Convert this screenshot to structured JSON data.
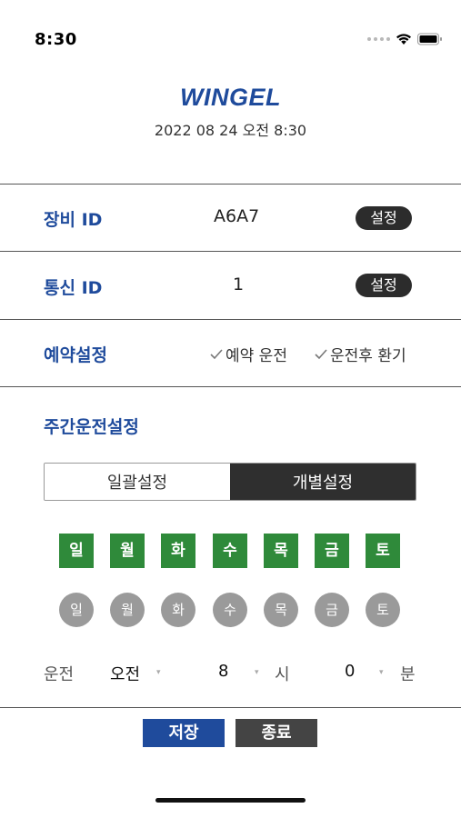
{
  "status": {
    "time": "8:30"
  },
  "header": {
    "logo": "WINGEL",
    "datetime": "2022 08 24 오전 8:30"
  },
  "device_id": {
    "label": "장비 ID",
    "value": "A6A7",
    "button": "설정"
  },
  "comm_id": {
    "label": "통신 ID",
    "value": "1",
    "button": "설정"
  },
  "reservation": {
    "label": "예약설정",
    "option1": "예약 운전",
    "option2": "운전후 환기"
  },
  "weekly": {
    "label": "주간운전설정",
    "segment_bulk": "일괄설정",
    "segment_individual": "개별설정",
    "selected_segment": "개별설정",
    "days_active": [
      "일",
      "월",
      "화",
      "수",
      "목",
      "금",
      "토"
    ],
    "days_inactive": [
      "일",
      "월",
      "화",
      "수",
      "목",
      "금",
      "토"
    ],
    "active_color": "#2f8a3a",
    "inactive_color": "#9a9a9a"
  },
  "schedule": {
    "label": "운전",
    "ampm": "오전",
    "hour": "8",
    "hour_unit": "시",
    "minute": "0",
    "minute_unit": "분"
  },
  "footer": {
    "save": "저장",
    "exit": "종료"
  },
  "colors": {
    "brand": "#1f4b9c",
    "dark": "#2c2c2c"
  }
}
